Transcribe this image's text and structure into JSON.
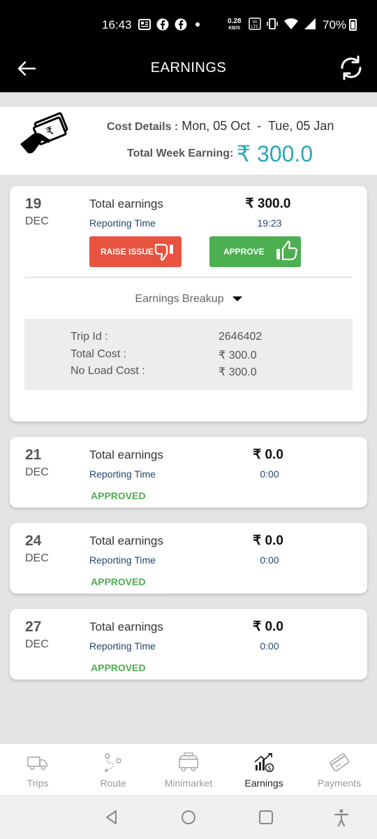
{
  "status_bar": {
    "time": "16:43",
    "speed_value": "0.28",
    "speed_unit": "KB/S",
    "battery": "70%"
  },
  "app_bar": {
    "title": "EARNINGS"
  },
  "cost_header": {
    "cost_details_label": "Cost Details :",
    "date_range": "Mon, 05 Oct  -  Tue, 05 Jan",
    "week_earning_label": "Total Week Earning:",
    "week_earning_value": "₹ 300.0"
  },
  "cards": [
    {
      "day": "19",
      "month": "DEC",
      "total_earnings_label": "Total earnings",
      "total_earnings_value": "₹ 300.0",
      "reporting_time_label": "Reporting Time",
      "reporting_time_value": "19:23",
      "raise_issue_label": "RAISE ISSUE",
      "approve_label": "APPROVE",
      "breakup_label": "Earnings Breakup",
      "breakup": [
        {
          "label": "Trip Id :",
          "value": "2646402"
        },
        {
          "label": "Total Cost :",
          "value": "₹ 300.0"
        },
        {
          "label": "No Load Cost :",
          "value": "₹ 300.0"
        }
      ]
    },
    {
      "day": "21",
      "month": "DEC",
      "total_earnings_label": "Total earnings",
      "total_earnings_value": "₹ 0.0",
      "reporting_time_label": "Reporting Time",
      "reporting_time_value": "0:00",
      "status": "APPROVED"
    },
    {
      "day": "24",
      "month": "DEC",
      "total_earnings_label": "Total earnings",
      "total_earnings_value": "₹ 0.0",
      "reporting_time_label": "Reporting Time",
      "reporting_time_value": "0:00",
      "status": "APPROVED"
    },
    {
      "day": "27",
      "month": "DEC",
      "total_earnings_label": "Total earnings",
      "total_earnings_value": "₹ 0.0",
      "reporting_time_label": "Reporting Time",
      "reporting_time_value": "0:00",
      "status": "APPROVED"
    }
  ],
  "bottom_nav": {
    "items": [
      {
        "label": "Trips",
        "icon": "truck-icon"
      },
      {
        "label": "Route",
        "icon": "route-icon"
      },
      {
        "label": "Minimarket",
        "icon": "minimarket-icon"
      },
      {
        "label": "Earnings",
        "icon": "earnings-chart-icon",
        "active": true
      },
      {
        "label": "Payments",
        "icon": "card-icon"
      }
    ]
  },
  "colors": {
    "accent": "#2aa6b8",
    "raise_issue": "#e8533f",
    "approve": "#4caf50",
    "approved_text": "#4caf50",
    "reporting_text": "#24466e"
  }
}
